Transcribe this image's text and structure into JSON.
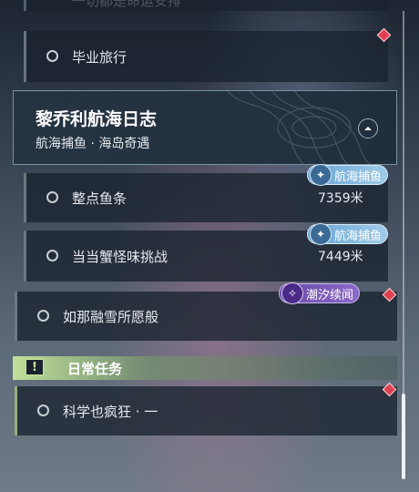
{
  "partial_top_item": "一切都是命运安排",
  "tasks": [
    {
      "label": "毕业旅行"
    },
    {
      "label": "整点鱼条",
      "tag": "航海捕鱼",
      "distance": "7359米"
    },
    {
      "label": "当当蟹怪味挑战",
      "tag": "航海捕鱼",
      "distance": "7449米"
    },
    {
      "label": "如那融雪所愿般",
      "tag": "潮汐续闻"
    },
    {
      "label": "科学也疯狂 · 一"
    }
  ],
  "quest_header": {
    "title": "黎乔利航海日志",
    "subtitle": "航海捕鱼 · 海岛奇遇"
  },
  "section": {
    "icon": "exclamation-icon",
    "title": "日常任务"
  },
  "colors": {
    "accent_green": "#c6e69a",
    "gem_red": "#e0404f",
    "tag_blue": "#8fc1e3",
    "tag_purple": "#7a58b8"
  }
}
